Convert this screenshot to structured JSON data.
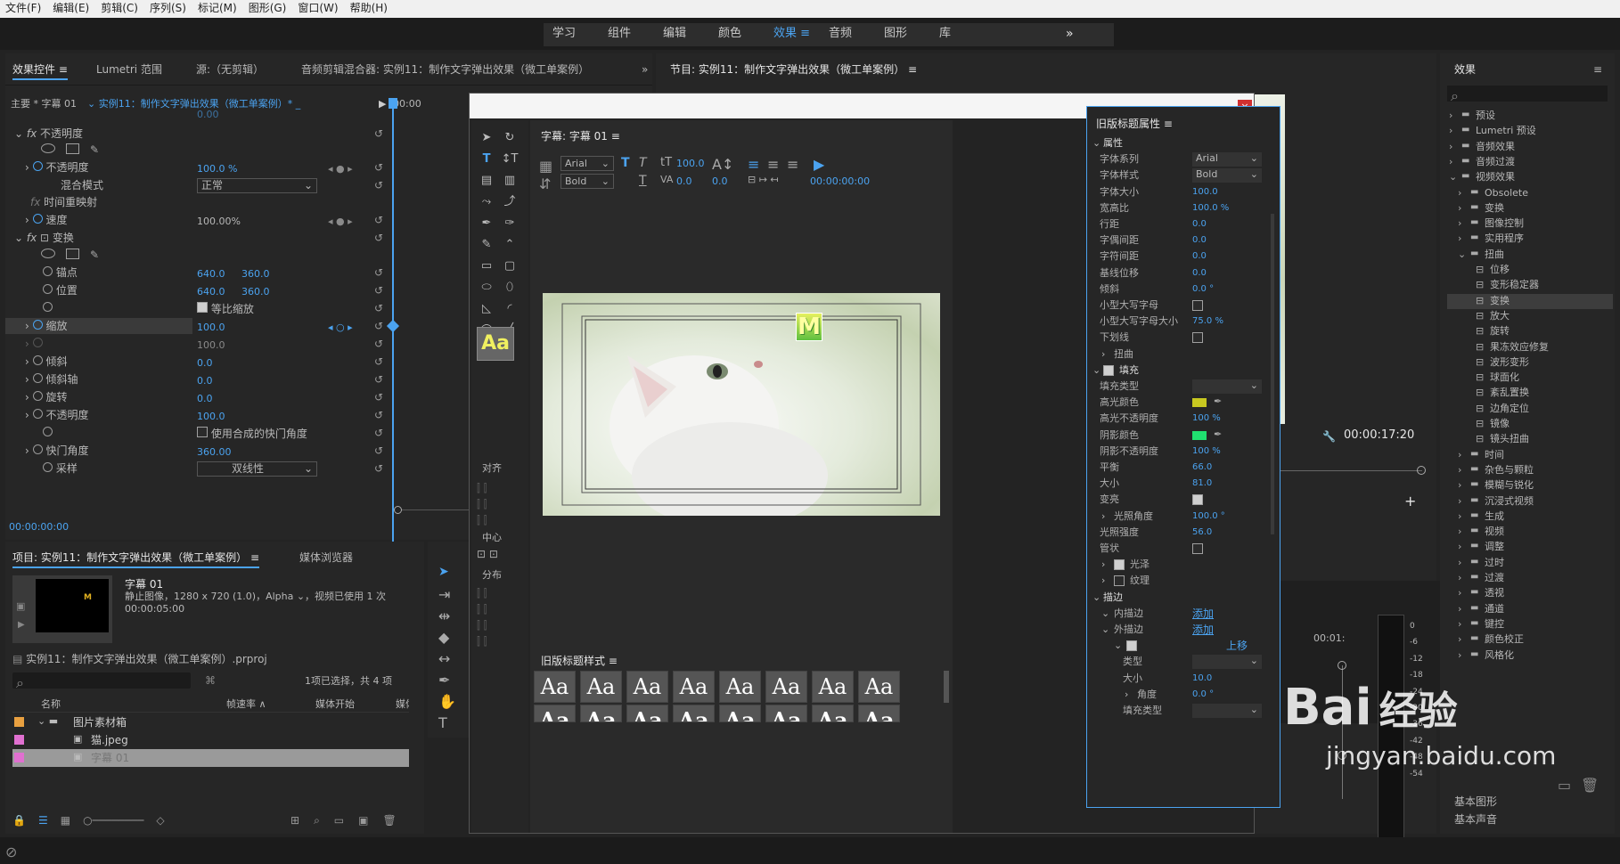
{
  "menubar": [
    "文件(F)",
    "编辑(E)",
    "剪辑(C)",
    "序列(S)",
    "标记(M)",
    "图形(G)",
    "窗口(W)",
    "帮助(H)"
  ],
  "workspaces": {
    "items": [
      "学习",
      "组件",
      "编辑",
      "颜色",
      "效果",
      "音频",
      "图形",
      "库"
    ],
    "active": "效果",
    "more": "»"
  },
  "effect_controls": {
    "tabs": [
      "效果控件",
      "Lumetri 范围",
      "源:（无剪辑）",
      "音频剪辑混合器: 实例11：制作文字弹出效果（微工单案例）"
    ],
    "master": "主要 * 字幕 01",
    "clip": "实例11：制作文字弹出效果（微工单案例）* _",
    "time_start": "00:00",
    "cut_row": "0.00",
    "opacity_group": "不透明度",
    "opacity_label": "不透明度",
    "opacity_value": "100.0 %",
    "blend_label": "混合模式",
    "blend_value": "正常",
    "remap_group": "时间重映射",
    "speed_label": "速度",
    "speed_value": "100.00%",
    "transform_group": "变换",
    "anchor_label": "锚点",
    "anchor_x": "640.0",
    "anchor_y": "360.0",
    "position_label": "位置",
    "position_x": "640.0",
    "position_y": "360.0",
    "uniform_label": "等比缩放",
    "scale_label": "缩放",
    "scale_value": "100.0",
    "scale2_value": "100.0",
    "skew_label": "倾斜",
    "skew_value": "0.0",
    "skewaxis_label": "倾斜轴",
    "skewaxis_value": "0.0",
    "rotation_label": "旋转",
    "rotation_value": "0.0",
    "opacity2_label": "不透明度",
    "opacity2_value": "100.0",
    "shutter_use_label": "使用合成的快门角度",
    "shutter_label": "快门角度",
    "shutter_value": "360.00",
    "sampling_label": "采样",
    "sampling_value": "双线性",
    "timecode": "00:00:00:00"
  },
  "program": {
    "title": "节目: 实例11：制作文字弹出效果（微工单案例）",
    "timecode": "00:00:17:20",
    "meter_labels": [
      "0",
      "-6",
      "-12",
      "-18",
      "-24",
      "-30",
      "-36",
      "-42",
      "-48",
      "-54"
    ],
    "ss": "S S",
    "ruler_time": "00:01:"
  },
  "project": {
    "tabs": [
      "项目: 实例11：制作文字弹出效果（微工单案例）",
      "媒体浏览器"
    ],
    "clip_name": "字幕 01",
    "clip_info": "静止图像，1280 x 720 (1.0)，Alpha ⌄，视频已使用 1 次",
    "clip_dur": "00:00:05:00",
    "project_file": "实例11：制作文字弹出效果（微工单案例）.prproj",
    "selection_info": "1项已选择，共 4 项",
    "columns": [
      "名称",
      "帧速率",
      "媒体开始",
      "媒体"
    ],
    "rows": [
      {
        "name": "图片素材箱",
        "color": "#e8a040"
      },
      {
        "name": "猫.jpeg",
        "color": "#e070d0"
      },
      {
        "name": "字幕 01",
        "color": "#e070d0"
      }
    ]
  },
  "effects": {
    "title": "效果",
    "items": [
      "预设",
      "Lumetri 预设",
      "音频效果",
      "音频过渡",
      "视频效果"
    ],
    "video_children": [
      "Obsolete",
      "变换",
      "图像控制",
      "实用程序",
      "扭曲"
    ],
    "distort_children": [
      "位移",
      "变形稳定器",
      "变换",
      "放大",
      "旋转",
      "果冻效应修复",
      "波形变形",
      "球面化",
      "紊乱置换",
      "边角定位",
      "镜像",
      "镜头扭曲"
    ],
    "after": [
      "时间",
      "杂色与颗粒",
      "模糊与锐化",
      "沉浸式视频",
      "生成",
      "视频",
      "调整",
      "过时",
      "过渡",
      "透视",
      "通道",
      "键控",
      "颜色校正",
      "风格化"
    ],
    "bottom": [
      "基本图形",
      "基本声音"
    ]
  },
  "title_dialog": {
    "title_tab": "字幕: 字幕 01",
    "font": "Arial",
    "style": "Bold",
    "size": "100.0",
    "kerning": "0.0",
    "leading": "0.0",
    "tc": "00:00:00:00",
    "align_label": "对齐",
    "center_label": "中心",
    "dist_label": "分布",
    "styles_label": "旧版标题样式",
    "aa": "Aa",
    "letter": "M",
    "props_title": "旧版标题属性",
    "props": [
      {
        "k": "属性",
        "type": "section"
      },
      {
        "k": "字体系列",
        "v": "Arial",
        "type": "dd"
      },
      {
        "k": "字体样式",
        "v": "Bold",
        "type": "dd"
      },
      {
        "k": "字体大小",
        "v": "100.0"
      },
      {
        "k": "宽高比",
        "v": "100.0 %"
      },
      {
        "k": "行距",
        "v": "0.0"
      },
      {
        "k": "字偶间距",
        "v": "0.0"
      },
      {
        "k": "字符间距",
        "v": "0.0"
      },
      {
        "k": "基线位移",
        "v": "0.0"
      },
      {
        "k": "倾斜",
        "v": "0.0 °"
      },
      {
        "k": "小型大写字母",
        "type": "cb"
      },
      {
        "k": "小型大写字母大小",
        "v": "75.0 %"
      },
      {
        "k": "下划线",
        "type": "cb"
      },
      {
        "k": "扭曲",
        "type": "sub"
      },
      {
        "k": "填充",
        "type": "sectioncb"
      },
      {
        "k": "填充类型",
        "v": "",
        "type": "dd"
      },
      {
        "k": "高光颜色",
        "type": "color",
        "c": "#c8c820"
      },
      {
        "k": "高光不透明度",
        "v": "100 %"
      },
      {
        "k": "阴影颜色",
        "type": "color",
        "c": "#20e070"
      },
      {
        "k": "阴影不透明度",
        "v": "100 %"
      },
      {
        "k": "平衡",
        "v": "66.0"
      },
      {
        "k": "大小",
        "v": "81.0"
      },
      {
        "k": "变亮",
        "type": "cbon"
      },
      {
        "k": "光照角度",
        "v": "100.0 °",
        "type": "subv"
      },
      {
        "k": "光照强度",
        "v": "56.0"
      },
      {
        "k": "管状",
        "type": "cb"
      },
      {
        "k": "光泽",
        "type": "subcbon"
      },
      {
        "k": "纹理",
        "type": "subcb"
      },
      {
        "k": "描边",
        "type": "section"
      },
      {
        "k": "内描边",
        "v": "添加",
        "type": "link"
      },
      {
        "k": "外描边",
        "v": "添加",
        "type": "link"
      },
      {
        "k": "",
        "v": "上移",
        "type": "cbrow"
      },
      {
        "k": "类型",
        "v": "",
        "type": "dd2"
      },
      {
        "k": "大小",
        "v": "10.0",
        "type": "ind"
      },
      {
        "k": "角度",
        "v": "0.0 °",
        "type": "subind"
      },
      {
        "k": "填充类型",
        "v": "",
        "type": "dd2"
      }
    ]
  },
  "watermark": {
    "line1": "Bai",
    "line2": "经验",
    "url": "jingyan.baidu.com"
  },
  "colors": {
    "accent": "#4ba3f0",
    "panel": "#262626"
  }
}
